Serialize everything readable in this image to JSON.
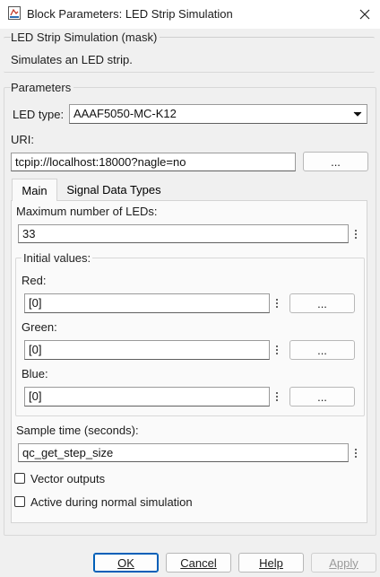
{
  "window": {
    "title": "Block Parameters: LED Strip Simulation"
  },
  "mask": {
    "heading": "LED Strip Simulation (mask)",
    "description": "Simulates an LED strip."
  },
  "parameters": {
    "heading": "Parameters",
    "led_type_label": "LED type:",
    "led_type_value": "AAAF5050-MC-K12",
    "uri_label": "URI:",
    "uri_value": "tcpip://localhost:18000?nagle=no",
    "browse_label": "..."
  },
  "tabs": [
    {
      "label": "Main"
    },
    {
      "label": "Signal Data Types"
    }
  ],
  "main": {
    "max_leds_label": "Maximum number of LEDs:",
    "max_leds_value": "33",
    "initial_values": {
      "heading": "Initial values:",
      "red_label": "Red:",
      "red_value": "[0]",
      "green_label": "Green:",
      "green_value": "[0]",
      "blue_label": "Blue:",
      "blue_value": "[0]",
      "browse_label": "..."
    },
    "sample_time_label": "Sample time (seconds):",
    "sample_time_value": "qc_get_step_size",
    "vector_outputs_label": "Vector outputs",
    "active_label": "Active during normal simulation"
  },
  "buttons": {
    "ok": "OK",
    "cancel": "Cancel",
    "help": "Help",
    "apply": "Apply"
  },
  "colors": {
    "ok_border": "#005fb8",
    "disabled_text": "#9a9a9a"
  }
}
